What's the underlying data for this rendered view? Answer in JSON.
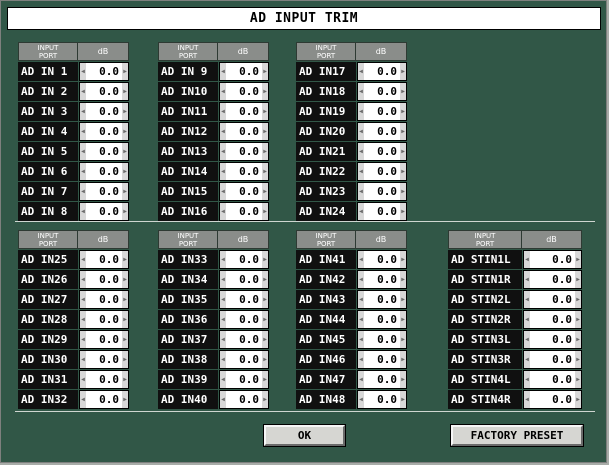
{
  "window": {
    "title": "AD INPUT TRIM"
  },
  "header": {
    "port": "INPUT\nPORT",
    "port_l1": "INPUT",
    "port_l2": "PORT",
    "db": "dB"
  },
  "channels": {
    "g1": [
      {
        "label": "AD IN 1",
        "value": "0.0"
      },
      {
        "label": "AD IN 2",
        "value": "0.0"
      },
      {
        "label": "AD IN 3",
        "value": "0.0"
      },
      {
        "label": "AD IN 4",
        "value": "0.0"
      },
      {
        "label": "AD IN 5",
        "value": "0.0"
      },
      {
        "label": "AD IN 6",
        "value": "0.0"
      },
      {
        "label": "AD IN 7",
        "value": "0.0"
      },
      {
        "label": "AD IN 8",
        "value": "0.0"
      }
    ],
    "g2": [
      {
        "label": "AD IN 9",
        "value": "0.0"
      },
      {
        "label": "AD IN10",
        "value": "0.0"
      },
      {
        "label": "AD IN11",
        "value": "0.0"
      },
      {
        "label": "AD IN12",
        "value": "0.0"
      },
      {
        "label": "AD IN13",
        "value": "0.0"
      },
      {
        "label": "AD IN14",
        "value": "0.0"
      },
      {
        "label": "AD IN15",
        "value": "0.0"
      },
      {
        "label": "AD IN16",
        "value": "0.0"
      }
    ],
    "g3": [
      {
        "label": "AD IN17",
        "value": "0.0"
      },
      {
        "label": "AD IN18",
        "value": "0.0"
      },
      {
        "label": "AD IN19",
        "value": "0.0"
      },
      {
        "label": "AD IN20",
        "value": "0.0"
      },
      {
        "label": "AD IN21",
        "value": "0.0"
      },
      {
        "label": "AD IN22",
        "value": "0.0"
      },
      {
        "label": "AD IN23",
        "value": "0.0"
      },
      {
        "label": "AD IN24",
        "value": "0.0"
      }
    ],
    "g4": [
      {
        "label": "AD IN25",
        "value": "0.0"
      },
      {
        "label": "AD IN26",
        "value": "0.0"
      },
      {
        "label": "AD IN27",
        "value": "0.0"
      },
      {
        "label": "AD IN28",
        "value": "0.0"
      },
      {
        "label": "AD IN29",
        "value": "0.0"
      },
      {
        "label": "AD IN30",
        "value": "0.0"
      },
      {
        "label": "AD IN31",
        "value": "0.0"
      },
      {
        "label": "AD IN32",
        "value": "0.0"
      }
    ],
    "g5": [
      {
        "label": "AD IN33",
        "value": "0.0"
      },
      {
        "label": "AD IN34",
        "value": "0.0"
      },
      {
        "label": "AD IN35",
        "value": "0.0"
      },
      {
        "label": "AD IN36",
        "value": "0.0"
      },
      {
        "label": "AD IN37",
        "value": "0.0"
      },
      {
        "label": "AD IN38",
        "value": "0.0"
      },
      {
        "label": "AD IN39",
        "value": "0.0"
      },
      {
        "label": "AD IN40",
        "value": "0.0"
      }
    ],
    "g6": [
      {
        "label": "AD IN41",
        "value": "0.0"
      },
      {
        "label": "AD IN42",
        "value": "0.0"
      },
      {
        "label": "AD IN43",
        "value": "0.0"
      },
      {
        "label": "AD IN44",
        "value": "0.0"
      },
      {
        "label": "AD IN45",
        "value": "0.0"
      },
      {
        "label": "AD IN46",
        "value": "0.0"
      },
      {
        "label": "AD IN47",
        "value": "0.0"
      },
      {
        "label": "AD IN48",
        "value": "0.0"
      }
    ],
    "g7": [
      {
        "label": "AD STIN1L",
        "value": "0.0"
      },
      {
        "label": "AD STIN1R",
        "value": "0.0"
      },
      {
        "label": "AD STIN2L",
        "value": "0.0"
      },
      {
        "label": "AD STIN2R",
        "value": "0.0"
      },
      {
        "label": "AD STIN3L",
        "value": "0.0"
      },
      {
        "label": "AD STIN3R",
        "value": "0.0"
      },
      {
        "label": "AD STIN4L",
        "value": "0.0"
      },
      {
        "label": "AD STIN4R",
        "value": "0.0"
      }
    ]
  },
  "buttons": {
    "ok": "OK",
    "factory_preset": "FACTORY PRESET"
  },
  "colors": {
    "background": "#315747",
    "label_bg": "#101010",
    "header_bg": "#8a8d8a",
    "value_bg": "#ffffff"
  },
  "icons": {
    "decrease": "left-arrow-icon",
    "increase": "right-arrow-icon"
  }
}
